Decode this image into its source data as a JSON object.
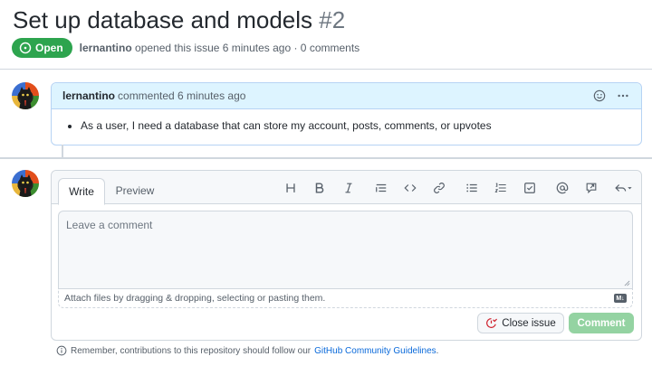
{
  "issue": {
    "title": "Set up database and models",
    "number": "#2",
    "state": "Open",
    "author": "lernantino",
    "opened_text": "opened this issue 6 minutes ago · 0 comments"
  },
  "comment": {
    "author": "lernantino",
    "action": "commented 6 minutes ago",
    "bullet": "As a user, I need a database that can store my account, posts, comments, or upvotes"
  },
  "composer": {
    "tabs": [
      "Write",
      "Preview"
    ],
    "placeholder": "Leave a comment",
    "attach_text": "Attach files by dragging & dropping, selecting or pasting them.",
    "markdown_badge": "M↓",
    "close_label": "Close issue",
    "comment_label": "Comment"
  },
  "toolbar_icons": [
    "heading-icon",
    "bold-icon",
    "italic-icon",
    "quote-icon",
    "code-icon",
    "link-icon",
    "bulleted-list-icon",
    "numbered-list-icon",
    "task-list-icon",
    "mention-icon",
    "reference-icon",
    "reply-icon"
  ],
  "footer": {
    "prefix": "Remember, contributions to this repository should follow our",
    "link": "GitHub Community Guidelines",
    "suffix": "."
  },
  "colors": {
    "open_green": "#2da44e",
    "comment_header_blue": "#ddf4ff",
    "link_blue": "#0969da",
    "disabled_green": "#94d3a2",
    "closed_red": "#cf222e"
  }
}
